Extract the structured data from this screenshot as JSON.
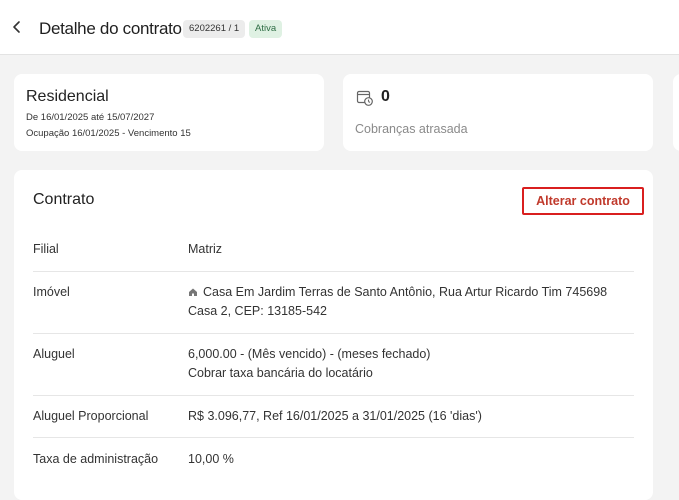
{
  "header": {
    "title": "Detalhe do contrato",
    "contract_id": "6202261 / 1",
    "status": "Ativa"
  },
  "summary": {
    "type_title": "Residencial",
    "period": "De 16/01/2025 até 15/07/2027",
    "occupancy": "Ocupação 16/01/2025 - Vencimento 15",
    "overdue_count": "0",
    "overdue_label": "Cobranças atrasada"
  },
  "contract": {
    "title": "Contrato",
    "edit_label": "Alterar contrato",
    "rows": [
      {
        "label": "Filial",
        "value": [
          "Matriz"
        ]
      },
      {
        "label": "Imóvel",
        "value": [
          "Casa Em Jardim Terras de Santo Antônio, Rua Artur Ricardo Tim 745698",
          "Casa 2, CEP: 13185-542"
        ]
      },
      {
        "label": "Aluguel",
        "value": [
          "6,000.00 - (Mês vencido) - (meses fechado)",
          "Cobrar taxa bancária do locatário"
        ]
      },
      {
        "label": "Aluguel Proporcional",
        "value": [
          "R$ 3.096,77, Ref 16/01/2025 a 31/01/2025 (16 'dias')"
        ]
      },
      {
        "label": "Taxa de administração",
        "value": [
          "10,00 %"
        ]
      }
    ]
  },
  "colors": {
    "accent_red": "#d91f1f",
    "status_green_bg": "#dff1e3",
    "status_green_text": "#2f6e45"
  },
  "icons": {
    "back": "chevron-left-icon",
    "overdue": "calendar-clock-icon",
    "property": "home-icon"
  }
}
